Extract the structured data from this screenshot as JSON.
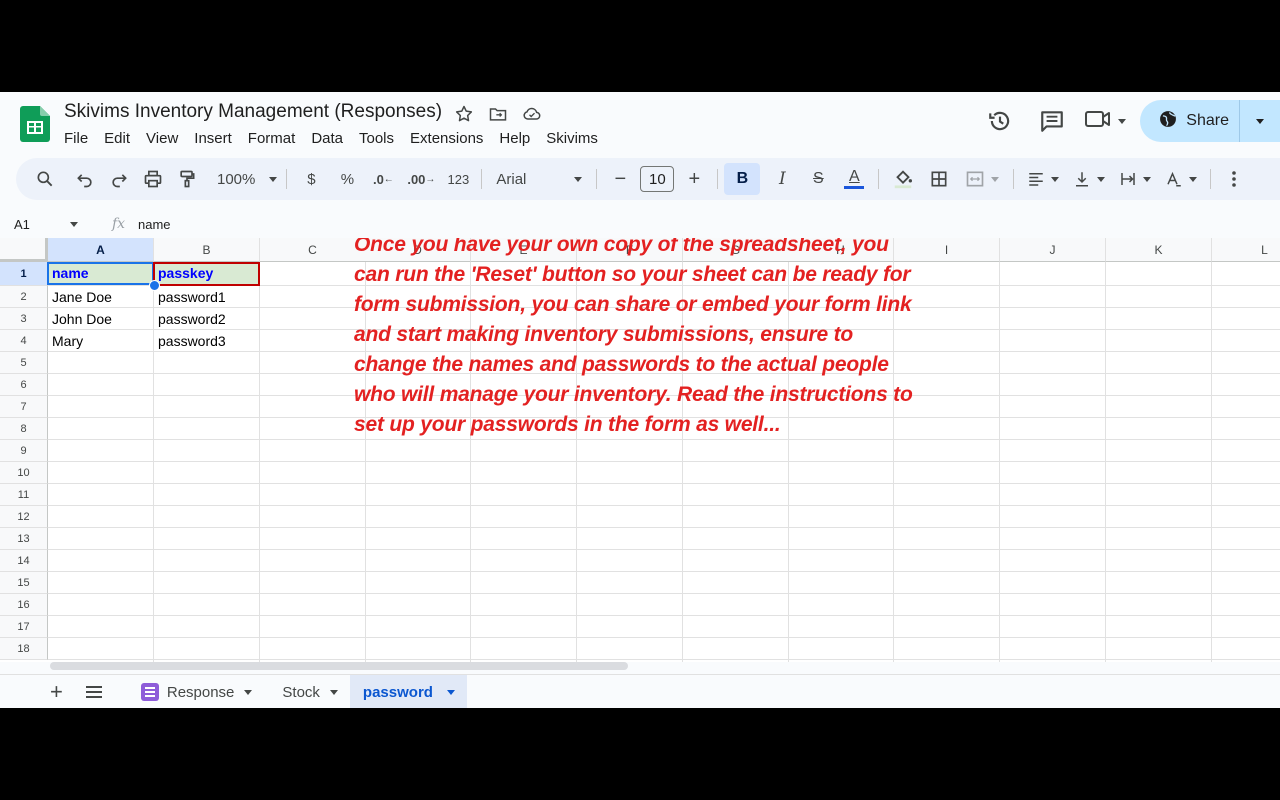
{
  "title_bar": {
    "doc_title": "Skivims Inventory Management (Responses)",
    "icons": [
      "star-icon",
      "move-folder-icon",
      "cloud-saved-icon"
    ]
  },
  "menu": [
    "File",
    "Edit",
    "View",
    "Insert",
    "Format",
    "Data",
    "Tools",
    "Extensions",
    "Help",
    "Skivims"
  ],
  "top_right": {
    "icons": [
      "history-icon",
      "comments-icon",
      "meet-icon"
    ],
    "share_label": "Share"
  },
  "toolbar": {
    "zoom": "100%",
    "currency": "$",
    "percent": "%",
    "dec_decrease": ".0",
    "dec_increase": ".00",
    "number_format": "123",
    "font": "Arial",
    "font_size": "10",
    "minus": "−",
    "plus": "+",
    "bold": "B",
    "italic": "I",
    "strike": "S",
    "text_color": "A",
    "text_color_hex": "#1a56db"
  },
  "formula_bar": {
    "cell_ref": "A1",
    "fx": "fx",
    "value": "name"
  },
  "grid": {
    "columns": [
      "A",
      "B",
      "C",
      "D",
      "E",
      "F",
      "G",
      "H",
      "I",
      "J",
      "K",
      "L"
    ],
    "rows": [
      "1",
      "2",
      "3",
      "4",
      "5",
      "6",
      "7",
      "8",
      "9",
      "10",
      "11",
      "12",
      "13",
      "14",
      "15",
      "16",
      "17",
      "18"
    ],
    "header_row": [
      "name",
      "passkey"
    ],
    "data_rows": [
      [
        "Jane Doe",
        "password1"
      ],
      [
        "John Doe",
        "password2"
      ],
      [
        "Mary",
        "password3"
      ]
    ],
    "note": "Once you have your own copy of the spreadsheet, you can run the 'Reset' button so your sheet can be ready for form submission, you can share or embed your form link and start making inventory submissions, ensure to change the names and passwords to the actual people who will manage your inventory. Read the instructions to set up your passwords in the form as well...",
    "note_color": "#e32121"
  },
  "sheet_tabs": [
    {
      "label": "Response",
      "icon": "form-icon",
      "active": false
    },
    {
      "label": "Stock",
      "active": false
    },
    {
      "label": "password",
      "active": true
    }
  ]
}
